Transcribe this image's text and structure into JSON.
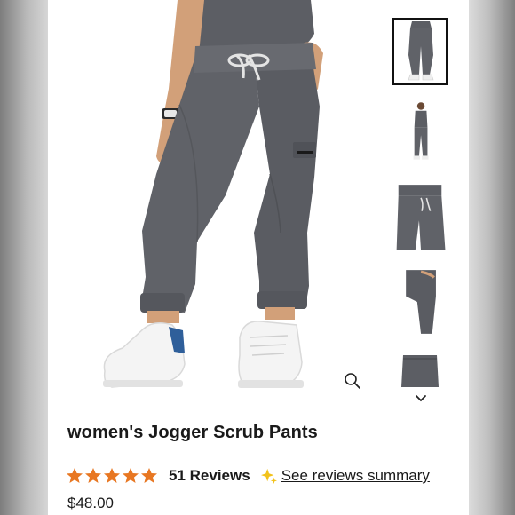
{
  "product": {
    "title": "women's Jogger Scrub Pants",
    "rating": {
      "value": 5,
      "max": 5
    },
    "reviews_label": "51 Reviews",
    "summary_link": "See reviews summary",
    "price": "$48.00"
  },
  "gallery": {
    "main_image": "jogger-pants-front-image",
    "zoom_icon": "magnifier-icon",
    "thumbnails": [
      {
        "name": "thumb-front-pants",
        "selected": true
      },
      {
        "name": "thumb-full-outfit",
        "selected": false
      },
      {
        "name": "thumb-waistband-detail",
        "selected": false
      },
      {
        "name": "thumb-side-view",
        "selected": false
      },
      {
        "name": "thumb-back-view",
        "selected": false
      }
    ],
    "next_icon": "chevron-down-icon"
  },
  "colors": {
    "star": "#e87722",
    "sparkle": "#f2c21b",
    "pants": "#606268",
    "text": "#1a1a1a"
  }
}
